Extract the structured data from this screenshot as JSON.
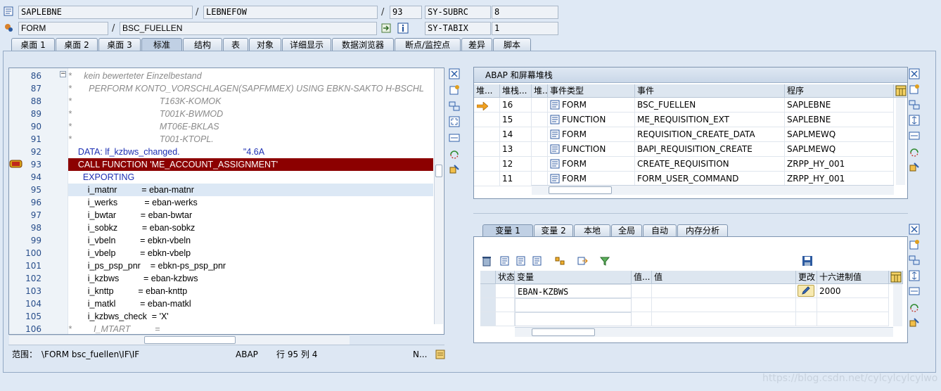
{
  "header": {
    "row1": {
      "program": "SAPLEBNE",
      "include": "LEBNEFOW",
      "line": "93",
      "sysvar_name": "SY-SUBRC",
      "sysvar_value": "8"
    },
    "row2": {
      "event_type": "FORM",
      "event_name": "BSC_FUELLEN",
      "sysvar_name": "SY-TABIX",
      "sysvar_value": "1"
    },
    "slash": "/"
  },
  "tabs": [
    "桌面 1",
    "桌面 2",
    "桌面 3",
    "标准",
    "结构",
    "表",
    "对象",
    "详细显示",
    "数据浏览器",
    "断点/监控点",
    "差异",
    "脚本"
  ],
  "active_tab": "标准",
  "code": {
    "lines": [
      {
        "n": "86",
        "text": "*     kein bewerteter Einzelbestand",
        "style": "comment"
      },
      {
        "n": "87",
        "text": "*       PERFORM KONTO_VORSCHLAGEN(SAPFMMEX) USING EBKN-SAKTO H-BSCHL",
        "style": "comment"
      },
      {
        "n": "88",
        "text": "*                                    T163K-KOMOK",
        "style": "comment"
      },
      {
        "n": "89",
        "text": "*                                    T001K-BWMOD",
        "style": "comment"
      },
      {
        "n": "90",
        "text": "*                                    MT06E-BKLAS",
        "style": "comment"
      },
      {
        "n": "91",
        "text": "*                                    T001-KTOPL.",
        "style": "comment"
      },
      {
        "n": "92",
        "text": "    DATA: lf_kzbws_changed.                          \"4.6A",
        "style": "data"
      },
      {
        "n": "93",
        "text": "    CALL FUNCTION 'ME_ACCOUNT_ASSIGNMENT'",
        "style": "exec"
      },
      {
        "n": "94",
        "text": "      EXPORTING",
        "style": "kw"
      },
      {
        "n": "95",
        "text": "        i_matnr          = eban-matnr",
        "style": "cur"
      },
      {
        "n": "96",
        "text": "        i_werks           = eban-werks",
        "style": "plain"
      },
      {
        "n": "97",
        "text": "        i_bwtar          = eban-bwtar",
        "style": "plain"
      },
      {
        "n": "98",
        "text": "        i_sobkz          = eban-sobkz",
        "style": "plain"
      },
      {
        "n": "99",
        "text": "        i_vbeln          = ebkn-vbeln",
        "style": "plain"
      },
      {
        "n": "100",
        "text": "        i_vbelp          = ebkn-vbelp",
        "style": "plain"
      },
      {
        "n": "101",
        "text": "        i_ps_psp_pnr    = ebkn-ps_psp_pnr",
        "style": "plain"
      },
      {
        "n": "102",
        "text": "        i_kzbws          = eban-kzbws",
        "style": "plain"
      },
      {
        "n": "103",
        "text": "        i_knttp          = eban-knttp",
        "style": "plain"
      },
      {
        "n": "104",
        "text": "        i_matkl          = eban-matkl",
        "style": "plain"
      },
      {
        "n": "105",
        "text": "        i_kzbws_check  = 'X'",
        "style": "str"
      },
      {
        "n": "106",
        "text": "*         I_MTART          =",
        "style": "comment"
      }
    ]
  },
  "status": {
    "scope_label": "范围：",
    "scope_value": "\\FORM bsc_fuellen\\IF\\IF",
    "lang": "ABAP",
    "pos": "行  95 列   4",
    "mode": "N..."
  },
  "stack": {
    "title": "ABAP 和屏幕堆栈",
    "columns": [
      "堆...",
      "堆栈...",
      "堆...",
      "事件类型",
      "事件",
      "程序"
    ],
    "rows": [
      {
        "level": "16",
        "type": "FORM",
        "event": "BSC_FUELLEN",
        "program": "SAPLEBNE",
        "current": true
      },
      {
        "level": "15",
        "type": "FUNCTION",
        "event": "ME_REQUISITION_EXT",
        "program": "SAPLEBNE",
        "current": false
      },
      {
        "level": "14",
        "type": "FORM",
        "event": "REQUISITION_CREATE_DATA",
        "program": "SAPLMEWQ",
        "current": false
      },
      {
        "level": "13",
        "type": "FUNCTION",
        "event": "BAPI_REQUISITION_CREATE",
        "program": "SAPLMEWQ",
        "current": false
      },
      {
        "level": "12",
        "type": "FORM",
        "event": "CREATE_REQUISITION",
        "program": "ZRPP_HY_001",
        "current": false
      },
      {
        "level": "11",
        "type": "FORM",
        "event": "FORM_USER_COMMAND",
        "program": "ZRPP_HY_001",
        "current": false
      }
    ]
  },
  "var_tabs": [
    "变量 1",
    "变量 2",
    "本地",
    "全局",
    "自动",
    "内存分析"
  ],
  "vars": {
    "columns": [
      "状态",
      "变量",
      "值...",
      "值",
      "更改",
      "十六进制值"
    ],
    "rows": [
      {
        "name": "EBAN-KZBWS",
        "value": "",
        "hex": "2000"
      }
    ]
  },
  "watermark": "https://blog.csdn.net/cylcylcylcylwo"
}
